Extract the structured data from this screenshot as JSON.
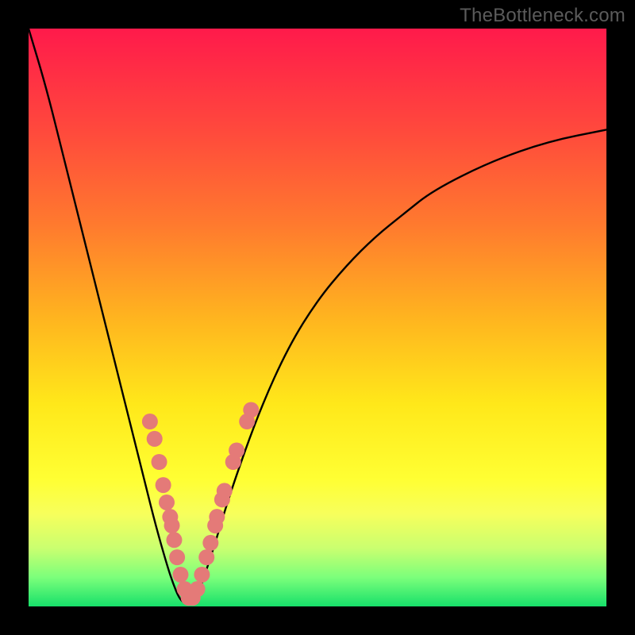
{
  "watermark": {
    "text": "TheBottleneck.com"
  },
  "palette": {
    "black": "#000000",
    "curve": "#000000",
    "marker_fill": "#e47a78",
    "marker_stroke": "none"
  },
  "chart_data": {
    "type": "line",
    "title": "",
    "xlabel": "",
    "ylabel": "",
    "xlim": [
      0,
      100
    ],
    "ylim": [
      0,
      100
    ],
    "grid": false,
    "legend": false,
    "series": [
      {
        "name": "bottleneck-curve",
        "x": [
          0,
          3,
          6,
          9,
          12,
          15,
          18,
          20,
          22,
          24,
          25,
          26,
          27,
          28,
          29,
          30,
          32,
          35,
          40,
          45,
          50,
          55,
          60,
          65,
          70,
          80,
          90,
          100
        ],
        "y": [
          100,
          90,
          78,
          66,
          54,
          42,
          30,
          22,
          14,
          7,
          4,
          1.5,
          0.5,
          0.5,
          1.5,
          4,
          10,
          20,
          34,
          45,
          53,
          59,
          64,
          68,
          72,
          77,
          80.5,
          82.5
        ]
      }
    ],
    "markers": {
      "name": "highlight-dots",
      "points": [
        {
          "x": 21.0,
          "y": 32.0
        },
        {
          "x": 21.8,
          "y": 29.0
        },
        {
          "x": 22.6,
          "y": 25.0
        },
        {
          "x": 23.3,
          "y": 21.0
        },
        {
          "x": 23.9,
          "y": 18.0
        },
        {
          "x": 24.5,
          "y": 15.5
        },
        {
          "x": 24.8,
          "y": 14.0
        },
        {
          "x": 25.2,
          "y": 11.5
        },
        {
          "x": 25.7,
          "y": 8.5
        },
        {
          "x": 26.3,
          "y": 5.5
        },
        {
          "x": 27.0,
          "y": 3.0
        },
        {
          "x": 27.7,
          "y": 1.5
        },
        {
          "x": 28.4,
          "y": 1.5
        },
        {
          "x": 29.2,
          "y": 3.0
        },
        {
          "x": 30.0,
          "y": 5.5
        },
        {
          "x": 30.8,
          "y": 8.5
        },
        {
          "x": 31.5,
          "y": 11.0
        },
        {
          "x": 32.3,
          "y": 14.0
        },
        {
          "x": 32.6,
          "y": 15.5
        },
        {
          "x": 33.5,
          "y": 18.5
        },
        {
          "x": 33.9,
          "y": 20.0
        },
        {
          "x": 35.4,
          "y": 25.0
        },
        {
          "x": 36.0,
          "y": 27.0
        },
        {
          "x": 37.8,
          "y": 32.0
        },
        {
          "x": 38.5,
          "y": 34.0
        }
      ],
      "radius": 10
    }
  }
}
